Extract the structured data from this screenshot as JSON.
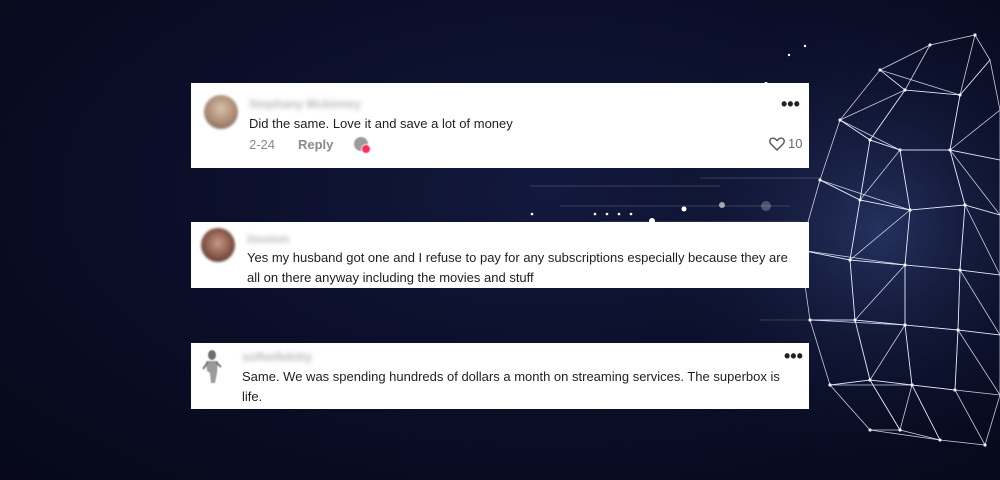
{
  "comments": [
    {
      "username": "Stephany Mckinney",
      "text": "Did the same. Love it and save a lot of money",
      "date": "2-24",
      "reply_label": "Reply",
      "likes": "10"
    },
    {
      "username": "itsvmm",
      "text": "Yes my husband got one and I refuse to pay for any subscriptions especially because they are all on there anyway including the movies and stuff"
    },
    {
      "username": "softwifekitty",
      "text": "Same. We was spending hundreds of dollars a month on streaming services. The superbox is life."
    }
  ],
  "more_symbol": "•••",
  "colors": {
    "background": "#0b0f2a",
    "card": "#ffffff",
    "like_badge": "#fe2c55"
  },
  "icons": [
    "more-options-icon",
    "heart-icon",
    "creator-liked-badge-icon"
  ]
}
